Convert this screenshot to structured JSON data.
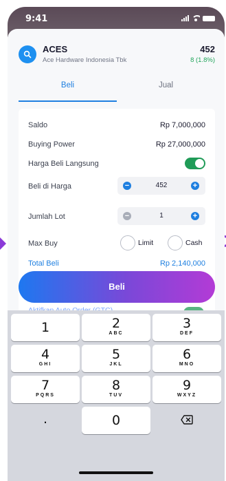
{
  "status": {
    "time": "9:41"
  },
  "stock": {
    "ticker": "ACES",
    "company": "Ace Hardware Indonesia Tbk",
    "price": "452",
    "change": "8 (1.8%)",
    "logo_icon": "search-icon"
  },
  "tabs": [
    {
      "label": "Beli",
      "active": true
    },
    {
      "label": "Jual",
      "active": false
    }
  ],
  "form": {
    "saldo_label": "Saldo",
    "saldo_value": "Rp 7,000,000",
    "buying_power_label": "Buying Power",
    "buying_power_value": "Rp 27,000,000",
    "harga_langsung_label": "Harga Beli Langsung",
    "harga_langsung_on": true,
    "beli_harga_label": "Beli di Harga",
    "beli_harga_value": "452",
    "jumlah_lot_label": "Jumlah Lot",
    "jumlah_lot_value": "1",
    "max_buy_label": "Max Buy",
    "max_buy_options": [
      "Limit",
      "Cash"
    ],
    "total_label": "Total Beli",
    "total_value": "Rp 2,140,000",
    "peek_label": "Aktifkan Auto Order (GTC)"
  },
  "buy_button": {
    "label": "Beli"
  },
  "keyboard": {
    "keys": [
      {
        "num": "1",
        "sub": ""
      },
      {
        "num": "2",
        "sub": "ABC"
      },
      {
        "num": "3",
        "sub": "DEF"
      },
      {
        "num": "4",
        "sub": "GHI"
      },
      {
        "num": "5",
        "sub": "JKL"
      },
      {
        "num": "6",
        "sub": "MNO"
      },
      {
        "num": "7",
        "sub": "PQRS"
      },
      {
        "num": "8",
        "sub": "TUV"
      },
      {
        "num": "9",
        "sub": "WXYZ"
      },
      {
        "num": ".",
        "sub": ""
      },
      {
        "num": "0",
        "sub": ""
      }
    ],
    "delete_icon": "backspace-icon"
  },
  "colors": {
    "accent": "#1e7fe0",
    "positive": "#22a55b",
    "toggle_on": "#1f9b57",
    "stepper_plus": "#1e7fe0",
    "stepper_minus_beli": "#1e7fe0",
    "stepper_minus_lot": "#a8adb8",
    "gradient_start": "#1e78f0",
    "gradient_end": "#b33bd6"
  }
}
